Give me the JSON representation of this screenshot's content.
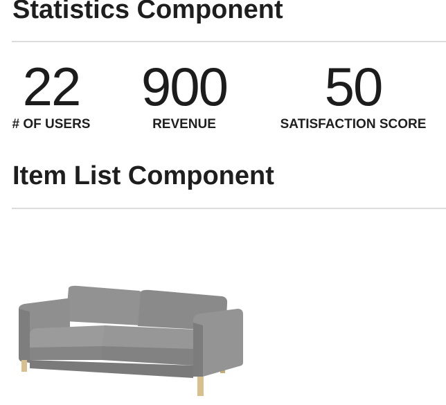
{
  "statistics": {
    "heading": "Statistics Component",
    "items": [
      {
        "value": "22",
        "label": "# OF USERS"
      },
      {
        "value": "900",
        "label": "REVENUE"
      },
      {
        "value": "50",
        "label": "SATISFACTION SCORE"
      }
    ]
  },
  "item_list": {
    "heading": "Item List Component",
    "items": [
      {
        "image": "sofa-image"
      }
    ]
  },
  "colors": {
    "text": "#1f1f1f",
    "divider": "#dcdcdc",
    "sofa_fabric": "#8c8c8c",
    "sofa_legs": "#d8bf8e"
  }
}
